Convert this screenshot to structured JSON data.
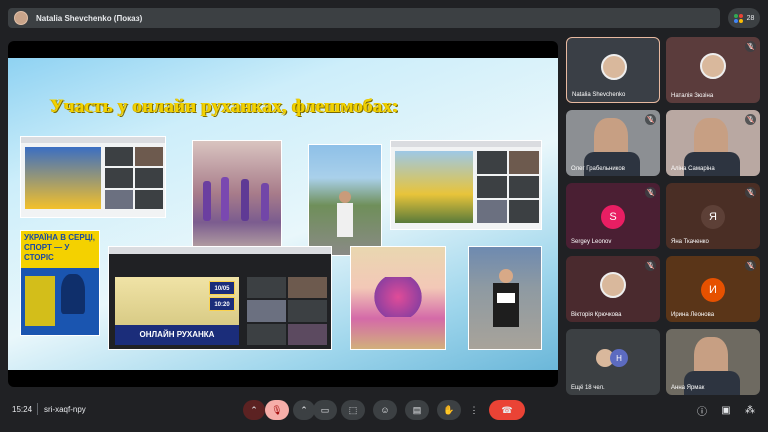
{
  "top": {
    "presenter_title": "Natalia Shevchenko (Показ)",
    "people_count": "28"
  },
  "slide": {
    "title": "Участь у онлайн руханках, флешмобах:",
    "poster_text": "УКРАЇНА В СЕРЦІ, СПОРТ — У СТОРІС",
    "promo_text": "ОНЛАЙН РУХАНКА",
    "promo_dates": [
      "10/05",
      "10:20"
    ]
  },
  "participants": [
    {
      "name": "Natalia Shevchenko",
      "muted": false,
      "type": "photo",
      "bg": "#3a3f46",
      "active": true
    },
    {
      "name": "Наталія Зюзіна",
      "muted": true,
      "type": "photo",
      "bg": "#5b3c3c"
    },
    {
      "name": "Олег Грабельников",
      "muted": true,
      "type": "video",
      "bg": "#8c8f93"
    },
    {
      "name": "Аліна Самаріна",
      "muted": true,
      "type": "video",
      "bg": "#b9a8a2"
    },
    {
      "name": "Sergey Leonov",
      "muted": true,
      "type": "letter",
      "letter": "S",
      "bg": "#4a1f33",
      "avatar": "#e91e63"
    },
    {
      "name": "Яна Ткаченко",
      "muted": true,
      "type": "letter",
      "letter": "Я",
      "bg": "#4a2e25",
      "avatar": "#5d4037"
    },
    {
      "name": "Вікторія Крючкова",
      "muted": true,
      "type": "photo",
      "bg": "#4a2a2e"
    },
    {
      "name": "Ирина Леонова",
      "muted": true,
      "type": "letter",
      "letter": "И",
      "bg": "#5a3518",
      "avatar": "#e65100"
    },
    {
      "name": "Ещё 18 чел.",
      "muted": false,
      "type": "more",
      "bg": "#3c4043"
    },
    {
      "name": "Анна Ярмак",
      "muted": false,
      "type": "video",
      "bg": "#6e6a61"
    }
  ],
  "bottom": {
    "time": "15:24",
    "meeting_code": "sri-xaqf-npy"
  },
  "colors": {
    "accent_red": "#ea4335",
    "surface": "#3c4043",
    "bg": "#202124",
    "title_yellow": "#f2d200"
  }
}
